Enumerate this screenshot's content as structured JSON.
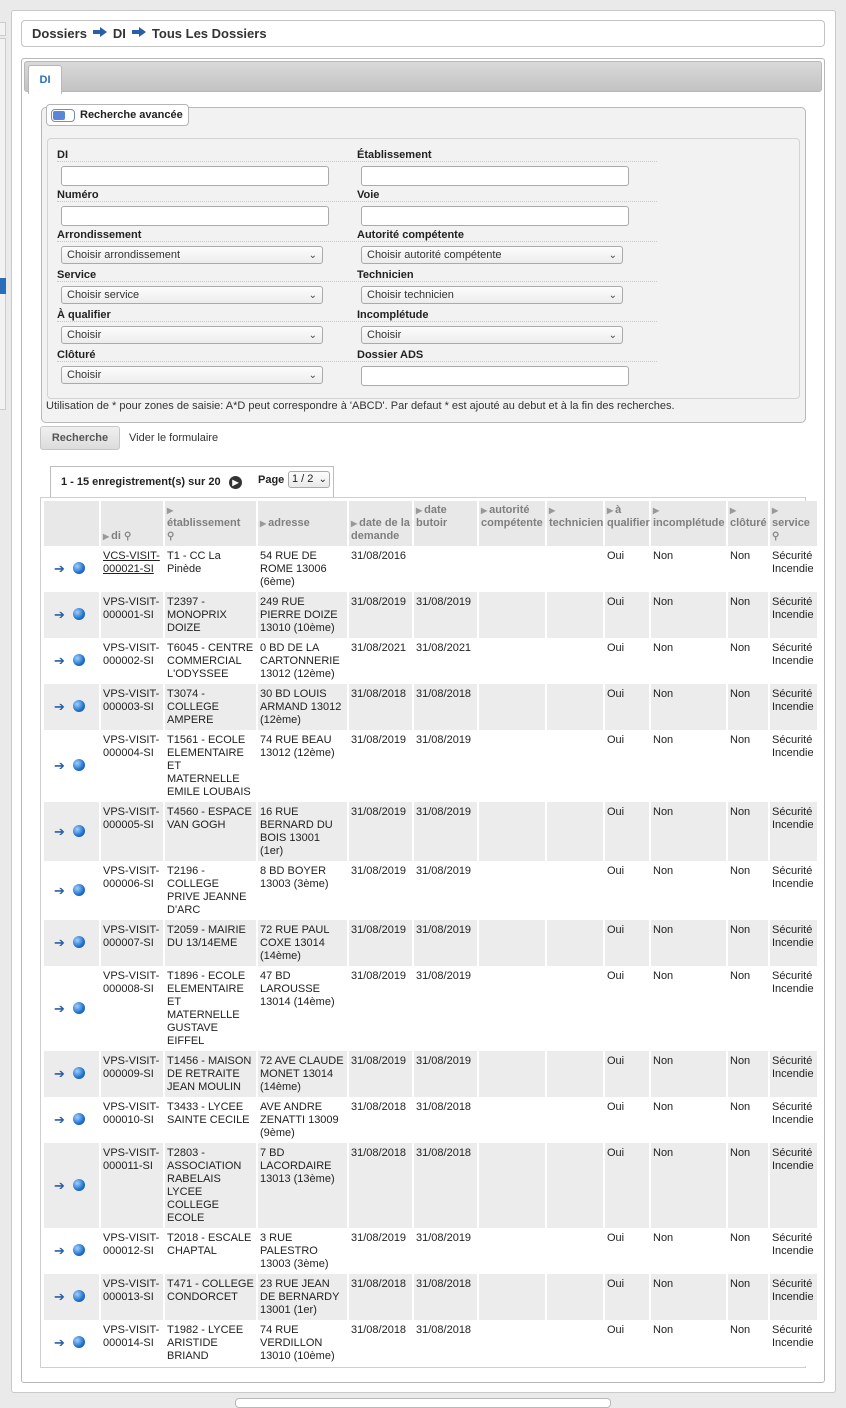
{
  "breadcrumb": {
    "items": [
      "Dossiers",
      "DI",
      "Tous Les Dossiers"
    ]
  },
  "tabs": [
    {
      "label": "DI"
    }
  ],
  "search": {
    "toggle_label": "Recherche avancée",
    "fields": {
      "di": {
        "label": "DI",
        "value": ""
      },
      "etablissement": {
        "label": "Établissement",
        "value": ""
      },
      "numero": {
        "label": "Numéro",
        "value": ""
      },
      "voie": {
        "label": "Voie",
        "value": ""
      },
      "arrondissement": {
        "label": "Arrondissement",
        "value": "Choisir arrondissement"
      },
      "autorite": {
        "label": "Autorité compétente",
        "value": "Choisir autorité compétente"
      },
      "service": {
        "label": "Service",
        "value": "Choisir service"
      },
      "technicien": {
        "label": "Technicien",
        "value": "Choisir technicien"
      },
      "a_qualifier": {
        "label": "À qualifier",
        "value": "Choisir"
      },
      "incompletude": {
        "label": "Incomplétude",
        "value": "Choisir"
      },
      "cloture": {
        "label": "Clôturé",
        "value": "Choisir"
      },
      "dossier_ads": {
        "label": "Dossier ADS",
        "value": ""
      }
    },
    "hint": "Utilisation de * pour zones de saisie: A*D peut correspondre à 'ABCD'. Par defaut * est ajouté au debut et à la fin des recherches.",
    "submit_label": "Recherche",
    "clear_label": "Vider le formulaire"
  },
  "pagination": {
    "count_text": "1 - 15 enregistrement(s) sur 20",
    "page_label": "Page",
    "page_value": "1 / 2"
  },
  "table": {
    "columns": [
      "di",
      "établissement",
      "adresse",
      "date de la demande",
      "date butoir",
      "autorité compétente",
      "technicien",
      "à qualifier",
      "incomplétude",
      "clôturé",
      "service"
    ],
    "rows": [
      [
        "VCS-VISIT-000021-SI",
        "T1 - CC La Pinède",
        "54 RUE DE ROME 13006 (6ème)",
        "31/08/2016",
        "",
        "",
        "",
        "Oui",
        "Non",
        "Non",
        "Sécurité Incendie"
      ],
      [
        "VPS-VISIT-000001-SI",
        "T2397 - MONOPRIX DOIZE",
        "249 RUE PIERRE DOIZE 13010 (10ème)",
        "31/08/2019",
        "31/08/2019",
        "",
        "",
        "Oui",
        "Non",
        "Non",
        "Sécurité Incendie"
      ],
      [
        "VPS-VISIT-000002-SI",
        "T6045 - CENTRE COMMERCIAL L'ODYSSEE",
        "0 BD DE LA CARTONNERIE 13012 (12ème)",
        "31/08/2021",
        "31/08/2021",
        "",
        "",
        "Oui",
        "Non",
        "Non",
        "Sécurité Incendie"
      ],
      [
        "VPS-VISIT-000003-SI",
        "T3074 - COLLEGE AMPERE",
        "30 BD LOUIS ARMAND 13012 (12ème)",
        "31/08/2018",
        "31/08/2018",
        "",
        "",
        "Oui",
        "Non",
        "Non",
        "Sécurité Incendie"
      ],
      [
        "VPS-VISIT-000004-SI",
        "T1561 - ECOLE ELEMENTAIRE ET MATERNELLE EMILE LOUBAIS",
        "74 RUE BEAU 13012 (12ème)",
        "31/08/2019",
        "31/08/2019",
        "",
        "",
        "Oui",
        "Non",
        "Non",
        "Sécurité Incendie"
      ],
      [
        "VPS-VISIT-000005-SI",
        "T4560 - ESPACE VAN GOGH",
        "16 RUE BERNARD DU BOIS 13001 (1er)",
        "31/08/2019",
        "31/08/2019",
        "",
        "",
        "Oui",
        "Non",
        "Non",
        "Sécurité Incendie"
      ],
      [
        "VPS-VISIT-000006-SI",
        "T2196 - COLLEGE PRIVE JEANNE D'ARC",
        "8 BD BOYER 13003 (3ème)",
        "31/08/2019",
        "31/08/2019",
        "",
        "",
        "Oui",
        "Non",
        "Non",
        "Sécurité Incendie"
      ],
      [
        "VPS-VISIT-000007-SI",
        "T2059 - MAIRIE DU 13/14EME",
        "72 RUE PAUL COXE 13014 (14ème)",
        "31/08/2019",
        "31/08/2019",
        "",
        "",
        "Oui",
        "Non",
        "Non",
        "Sécurité Incendie"
      ],
      [
        "VPS-VISIT-000008-SI",
        "T1896 - ECOLE ELEMENTAIRE ET MATERNELLE GUSTAVE EIFFEL",
        "47 BD LAROUSSE 13014 (14ème)",
        "31/08/2019",
        "31/08/2019",
        "",
        "",
        "Oui",
        "Non",
        "Non",
        "Sécurité Incendie"
      ],
      [
        "VPS-VISIT-000009-SI",
        "T1456 - MAISON DE RETRAITE JEAN MOULIN",
        "72 AVE CLAUDE MONET 13014 (14ème)",
        "31/08/2019",
        "31/08/2019",
        "",
        "",
        "Oui",
        "Non",
        "Non",
        "Sécurité Incendie"
      ],
      [
        "VPS-VISIT-000010-SI",
        "T3433 - LYCEE SAINTE CECILE",
        "AVE ANDRE ZENATTI 13009 (9ème)",
        "31/08/2018",
        "31/08/2018",
        "",
        "",
        "Oui",
        "Non",
        "Non",
        "Sécurité Incendie"
      ],
      [
        "VPS-VISIT-000011-SI",
        "T2803 - ASSOCIATION RABELAIS LYCEE COLLEGE ECOLE",
        "7 BD LACORDAIRE 13013 (13ème)",
        "31/08/2018",
        "31/08/2018",
        "",
        "",
        "Oui",
        "Non",
        "Non",
        "Sécurité Incendie"
      ],
      [
        "VPS-VISIT-000012-SI",
        "T2018 - ESCALE CHAPTAL",
        "3 RUE PALESTRO 13003 (3ème)",
        "31/08/2019",
        "31/08/2019",
        "",
        "",
        "Oui",
        "Non",
        "Non",
        "Sécurité Incendie"
      ],
      [
        "VPS-VISIT-000013-SI",
        "T471 - COLLEGE CONDORCET",
        "23 RUE JEAN DE BERNARDY 13001 (1er)",
        "31/08/2018",
        "31/08/2018",
        "",
        "",
        "Oui",
        "Non",
        "Non",
        "Sécurité Incendie"
      ],
      [
        "VPS-VISIT-000014-SI",
        "T1982 - LYCEE ARISTIDE BRIAND",
        "74 RUE VERDILLON 13010 (10ème)",
        "31/08/2018",
        "31/08/2018",
        "",
        "",
        "Oui",
        "Non",
        "Non",
        "Sécurité Incendie"
      ]
    ]
  },
  "icons": {
    "row_open": "arrow-right-icon",
    "row_geo": "globe-icon",
    "sort": "sort-triangle-icon",
    "filter": "magnifier-icon"
  },
  "colors": {
    "link_blue": "#2a5ea8",
    "tab_text": "#2a6ebb",
    "header_bg": "#e8e8e8",
    "row_alt_bg": "#ececec"
  }
}
